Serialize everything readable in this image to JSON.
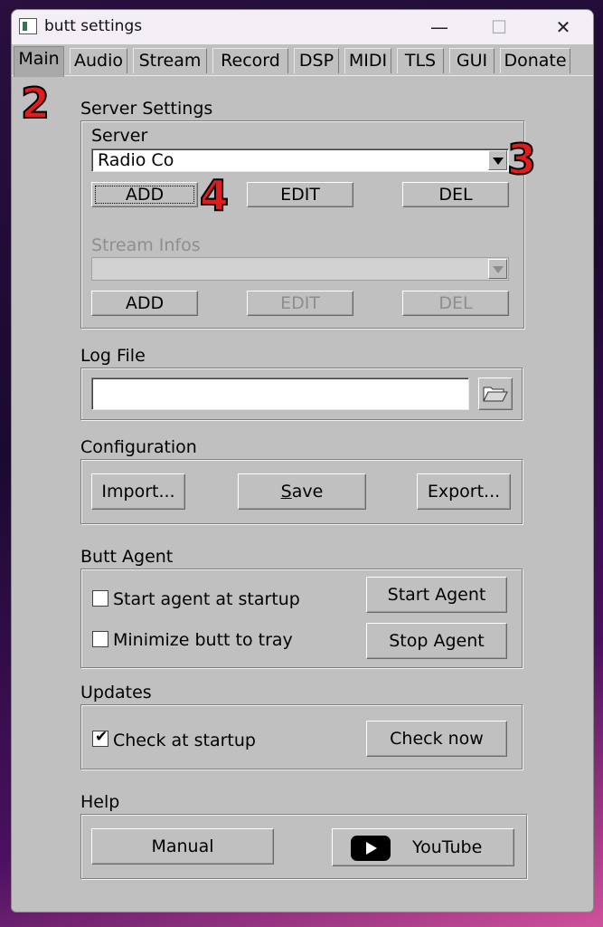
{
  "window": {
    "title": "butt settings",
    "minimize": "—",
    "maximize": "☐",
    "close": "✕"
  },
  "tabs": [
    "Main",
    "Audio",
    "Stream",
    "Record",
    "DSP",
    "MIDI",
    "TLS",
    "GUI",
    "Donate"
  ],
  "badges": {
    "b2": "2",
    "b3": "3",
    "b4": "4"
  },
  "server_settings": {
    "title": "Server Settings",
    "server_label": "Server",
    "server_value": "Radio Co",
    "add": "ADD",
    "edit": "EDIT",
    "del": "DEL",
    "stream_infos_label": "Stream Infos",
    "stream_value": "",
    "add2": "ADD",
    "edit2": "EDIT",
    "del2": "DEL"
  },
  "log_file": {
    "title": "Log File",
    "value": ""
  },
  "configuration": {
    "title": "Configuration",
    "import": "Import...",
    "save_s": "S",
    "save_rest": "ave",
    "export": "Export..."
  },
  "agent": {
    "title": "Butt Agent",
    "start_at_startup": "Start agent at startup",
    "minimize_tray": "Minimize butt to tray",
    "start_agent": "Start Agent",
    "stop_agent": "Stop Agent"
  },
  "updates": {
    "title": "Updates",
    "check_startup": "Check at startup",
    "check_mark": "✔",
    "check_now": "Check now"
  },
  "help": {
    "title": "Help",
    "manual": "Manual",
    "youtube": "YouTube"
  }
}
